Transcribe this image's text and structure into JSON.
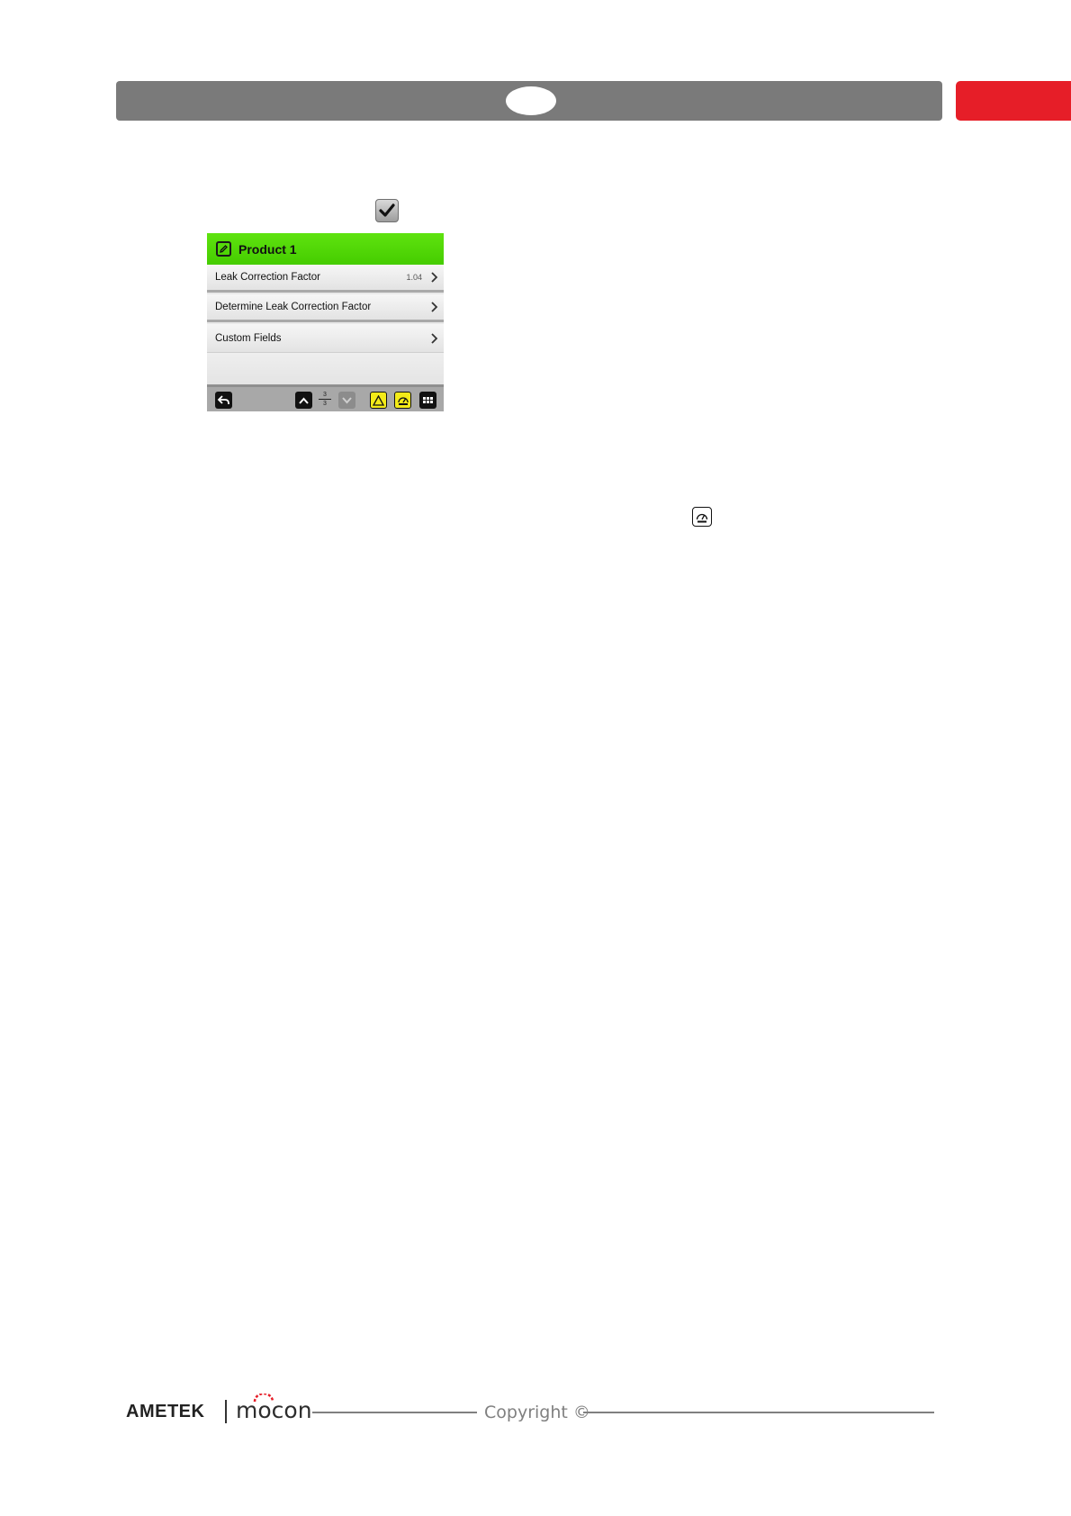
{
  "header": {
    "bar_color": "#7a7a7a",
    "tab_color": "#e61e28"
  },
  "confirm_icon": {
    "name": "checkmark-icon"
  },
  "screen": {
    "title": "Product 1",
    "header_color": "#4fd30a",
    "rows": [
      {
        "label": "Leak Correction Factor",
        "value": "1.04"
      },
      {
        "label": "Determine Leak Correction Factor",
        "value": ""
      },
      {
        "label": "Custom Fields",
        "value": ""
      }
    ],
    "toolbar": {
      "page_current": "3",
      "page_total": "3",
      "icons": [
        "back-icon",
        "page-up-icon",
        "page-down-icon",
        "warning-icon",
        "gauge-icon",
        "menu-grid-icon"
      ]
    }
  },
  "gauge_icon": {
    "name": "gauge-icon"
  },
  "footer": {
    "brand_ametek": "AMETEK",
    "brand_mocon": "mocon",
    "copyright": "Copyright ©"
  }
}
